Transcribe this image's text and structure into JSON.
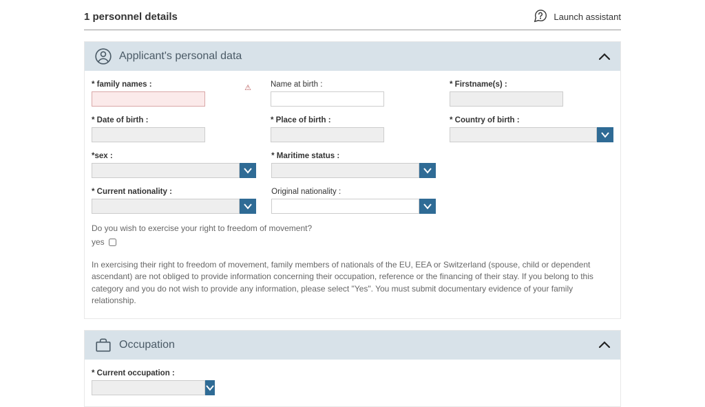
{
  "header": {
    "title": "1 personnel details",
    "launch_assistant": "Launch assistant"
  },
  "section_personal": {
    "title": "Applicant's personal data",
    "fields": {
      "family_names": "* family names :",
      "name_at_birth": "Name at birth :",
      "firstnames": "* Firstname(s) :",
      "date_of_birth": "* Date of birth :",
      "place_of_birth": "* Place of birth :",
      "country_of_birth": "* Country of birth :",
      "sex": "*sex :",
      "maritime_status": "* Maritime status :",
      "current_nationality": "* Current nationality :",
      "original_nationality": "Original nationality :"
    },
    "freedom_question": "Do you wish to exercise your right to freedom of movement?",
    "yes_label": "yes",
    "info": "In exercising their right to freedom of movement, family members of nationals of the EU, EEA or Switzerland (spouse, child or dependent ascendant) are not obliged to provide information concerning their occupation, reference or the financing of their stay. If you belong to this category and you do not wish to provide any information, please select \"Yes\". You must submit documentary evidence of your family relationship."
  },
  "section_occupation": {
    "title": "Occupation",
    "current_occupation": "* Current occupation :"
  }
}
